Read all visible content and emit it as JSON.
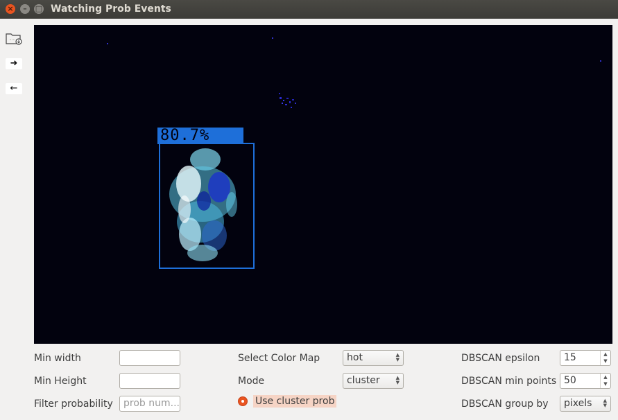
{
  "window": {
    "title": "Watching Prob Events"
  },
  "toolbar": {
    "open_icon": "folder-open-icon",
    "next_icon": "arrow-right-icon",
    "prev_icon": "arrow-left-icon",
    "next_glyph": "➜",
    "prev_glyph": "🡐"
  },
  "viewer": {
    "detection_label": "80.7%",
    "box_color": "#1e6fd9",
    "background": "#02020e"
  },
  "controls": {
    "min_width": {
      "label": "Min width",
      "value": ""
    },
    "min_height": {
      "label": "Min Height",
      "value": ""
    },
    "filter_probability": {
      "label": "Filter probability",
      "placeholder": "prob num..."
    },
    "color_map": {
      "label": "Select Color Map",
      "value": "hot"
    },
    "mode": {
      "label": "Mode",
      "value": "cluster"
    },
    "use_cluster_prob": {
      "label": "Use cluster prob",
      "checked": true
    },
    "dbscan_epsilon": {
      "label": "DBSCAN epsilon",
      "value": "15"
    },
    "dbscan_min_points": {
      "label": "DBSCAN min points",
      "value": "50"
    },
    "dbscan_group_by": {
      "label": "DBSCAN group by",
      "value": "pixels"
    }
  }
}
